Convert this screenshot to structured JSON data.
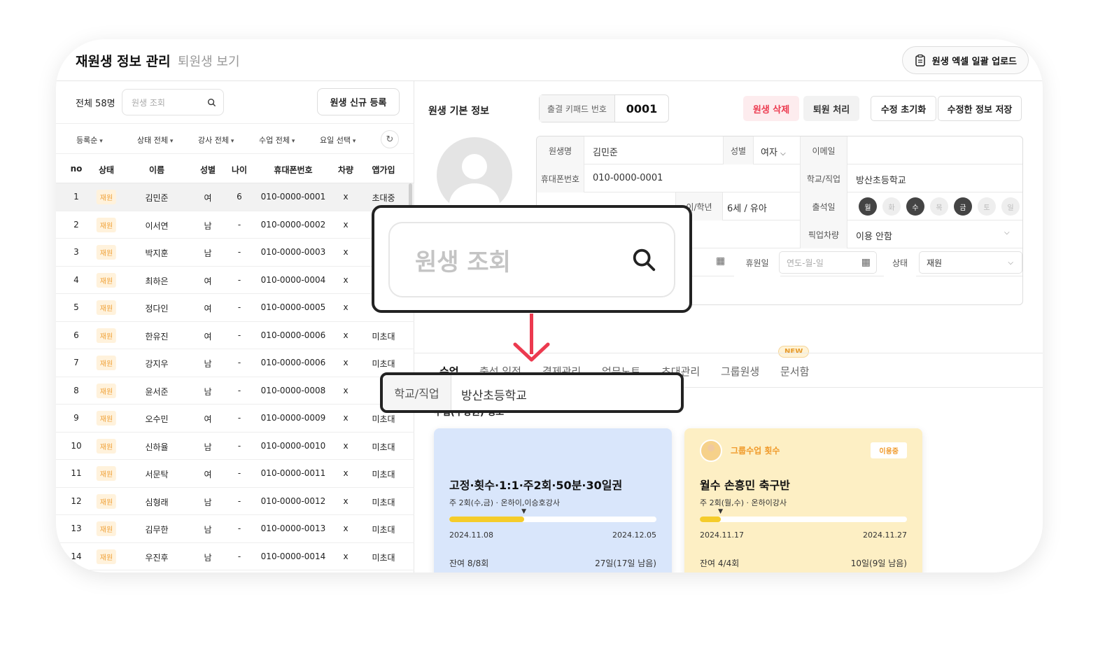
{
  "header": {
    "title": "재원생 정보 관리",
    "subtitle": "퇴원생 보기",
    "excel_upload": "원생 엑셀 일괄 업로드"
  },
  "left": {
    "total": "전체 58명",
    "search_placeholder": "원생 조회",
    "new_button": "원생 신규 등록",
    "filters": [
      "등록순",
      "상태 전체",
      "강사 전체",
      "수업 전체",
      "요일 선택"
    ],
    "columns": [
      "no",
      "상태",
      "이름",
      "성별",
      "나이",
      "휴대폰번호",
      "차량",
      "앱가입"
    ],
    "rows": [
      {
        "no": "1",
        "status": "재원",
        "name": "김민준",
        "gender": "여",
        "age": "6",
        "phone": "010-0000-0001",
        "car": "x",
        "app": "초대중"
      },
      {
        "no": "2",
        "status": "재원",
        "name": "이서연",
        "gender": "남",
        "age": "-",
        "phone": "010-0000-0002",
        "car": "x",
        "app": ""
      },
      {
        "no": "3",
        "status": "재원",
        "name": "박지훈",
        "gender": "남",
        "age": "-",
        "phone": "010-0000-0003",
        "car": "x",
        "app": ""
      },
      {
        "no": "4",
        "status": "재원",
        "name": "최하은",
        "gender": "여",
        "age": "-",
        "phone": "010-0000-0004",
        "car": "x",
        "app": ""
      },
      {
        "no": "5",
        "status": "재원",
        "name": "정다인",
        "gender": "여",
        "age": "-",
        "phone": "010-0000-0005",
        "car": "x",
        "app": ""
      },
      {
        "no": "6",
        "status": "재원",
        "name": "한유진",
        "gender": "여",
        "age": "-",
        "phone": "010-0000-0006",
        "car": "x",
        "app": "미초대"
      },
      {
        "no": "7",
        "status": "재원",
        "name": "강지우",
        "gender": "남",
        "age": "-",
        "phone": "010-0000-0006",
        "car": "x",
        "app": "미초대"
      },
      {
        "no": "8",
        "status": "재원",
        "name": "윤서준",
        "gender": "남",
        "age": "-",
        "phone": "010-0000-0008",
        "car": "x",
        "app": "미"
      },
      {
        "no": "9",
        "status": "재원",
        "name": "오수민",
        "gender": "여",
        "age": "-",
        "phone": "010-0000-0009",
        "car": "x",
        "app": "미초대"
      },
      {
        "no": "10",
        "status": "재원",
        "name": "신하율",
        "gender": "남",
        "age": "-",
        "phone": "010-0000-0010",
        "car": "x",
        "app": "미초대"
      },
      {
        "no": "11",
        "status": "재원",
        "name": "서문탁",
        "gender": "여",
        "age": "-",
        "phone": "010-0000-0011",
        "car": "x",
        "app": "미초대"
      },
      {
        "no": "12",
        "status": "재원",
        "name": "심형래",
        "gender": "남",
        "age": "-",
        "phone": "010-0000-0012",
        "car": "x",
        "app": "미초대"
      },
      {
        "no": "13",
        "status": "재원",
        "name": "김무한",
        "gender": "남",
        "age": "-",
        "phone": "010-0000-0013",
        "car": "x",
        "app": "미초대"
      },
      {
        "no": "14",
        "status": "재원",
        "name": "우진후",
        "gender": "남",
        "age": "-",
        "phone": "010-0000-0014",
        "car": "x",
        "app": "미초대"
      }
    ]
  },
  "right": {
    "section_title": "원생 기본 정보",
    "keypad_label": "출결 키패드 번호",
    "keypad_value": "0001",
    "buttons": {
      "delete": "원생 삭제",
      "withdraw": "퇴원 처리",
      "reset": "수정 초기화",
      "save": "수정한 정보 저장"
    },
    "info": {
      "name_label": "원생명",
      "name": "김민준",
      "gender_label": "성별",
      "gender": "여자",
      "email_label": "이메일",
      "phone_label": "휴대폰번호",
      "phone": "010-0000-0001",
      "school_label": "학교/직업",
      "school": "방산초등학교",
      "age_label": "이/학년",
      "age": "6세 / 유아",
      "attend_label": "출석일",
      "days": [
        "월",
        "화",
        "수",
        "목",
        "금",
        "토",
        "일"
      ],
      "pickup_label": "픽업차량",
      "pickup": "이용 안함",
      "leave_label": "휴원일",
      "date_placeholder": "연도-월-일",
      "status_label": "상태",
      "status": "재원"
    },
    "tabs": [
      "수업",
      "출석 일정",
      "결제관리",
      "업무노트",
      "초대관리",
      "그룹원생",
      "문서함"
    ],
    "new_badge": "NEW",
    "section2": "수업(수강권) 정보",
    "cards": [
      {
        "title": "고정·횟수·1:1·주2회·50분·30일권",
        "sub": "주 2회(수,금) · 온하이,이승호강사",
        "progress": 0.36,
        "start": "2024.11.08",
        "end": "2024.12.05",
        "remain": "잔여 8/8회",
        "days_left": "27일(17일 남음)"
      },
      {
        "group_name": "그룹수업 횟수",
        "using": "이용중",
        "title": "월수 손흥민 축구반",
        "sub": "주 2회(월,수) · 온하이강사",
        "progress": 0.1,
        "start": "2024.11.17",
        "end": "2024.11.27",
        "remain": "잔여 4/4회",
        "days_left": "10일(9일 남음)"
      }
    ]
  },
  "zoom": {
    "search_placeholder": "원생 조회",
    "field_label": "학교/직업",
    "field_value": "방산초등학교"
  },
  "colors": {
    "accent_red": "#ec3a4f",
    "status_orange": "#f0a23a",
    "card_blue": "#d9e6fb",
    "card_yellow": "#fdefc4",
    "progress": "#f5cc2a"
  }
}
